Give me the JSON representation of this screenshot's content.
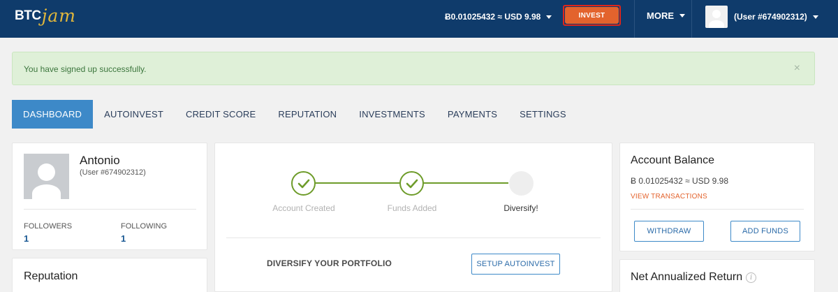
{
  "header": {
    "logo_left": "BTC",
    "logo_right": "jam",
    "balance": "Ƀ0.01025432 ≈ USD 9.98",
    "invest_label": "INVEST",
    "more_label": "MORE",
    "user_label": "(User #674902312)"
  },
  "alert": {
    "message": "You have signed up successfully.",
    "close_symbol": "×"
  },
  "tabs": [
    {
      "label": "DASHBOARD",
      "active": true
    },
    {
      "label": "AUTOINVEST",
      "active": false
    },
    {
      "label": "CREDIT SCORE",
      "active": false
    },
    {
      "label": "REPUTATION",
      "active": false
    },
    {
      "label": "INVESTMENTS",
      "active": false
    },
    {
      "label": "PAYMENTS",
      "active": false
    },
    {
      "label": "SETTINGS",
      "active": false
    }
  ],
  "profile": {
    "name": "Antonio",
    "user_id": "(User #674902312)",
    "followers_label": "FOLLOWERS",
    "followers_value": "1",
    "following_label": "FOLLOWING",
    "following_value": "1"
  },
  "reputation": {
    "title": "Reputation"
  },
  "progress": {
    "steps": [
      {
        "label": "Account Created",
        "status": "done"
      },
      {
        "label": "Funds Added",
        "status": "done"
      },
      {
        "label": "Diversify!",
        "status": "current"
      }
    ],
    "diversify_title": "DIVERSIFY YOUR PORTFOLIO",
    "setup_button": "SETUP AUTOINVEST"
  },
  "account_balance": {
    "title": "Account Balance",
    "balance": "Ƀ 0.01025432 ≈ USD 9.98",
    "view_transactions": "VIEW TRANSACTIONS",
    "withdraw_button": "WITHDRAW",
    "add_funds_button": "ADD FUNDS"
  },
  "net_return": {
    "title": "Net Annualized Return",
    "info_symbol": "i"
  },
  "colors": {
    "header_bg": "#0f3b6b",
    "invest_button": "#e3632d",
    "tab_active": "#3d89c8",
    "alert_bg": "#dff0d8",
    "progress_green": "#6e9c2a",
    "link_orange": "#e3632d"
  }
}
